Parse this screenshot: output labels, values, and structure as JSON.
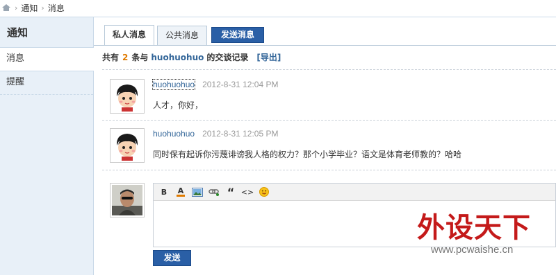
{
  "breadcrumb": {
    "home_icon": "home-icon",
    "items": [
      "通知",
      "消息"
    ],
    "separator": "›"
  },
  "sidebar": {
    "title": "通知",
    "items": [
      {
        "label": "消息",
        "active": true
      },
      {
        "label": "提醒",
        "active": false
      }
    ]
  },
  "tabs": {
    "private": "私人消息",
    "public": "公共消息",
    "send": "发送消息"
  },
  "summary": {
    "prefix": "共有",
    "count": "2",
    "mid": "条与",
    "user": "huohuohuo",
    "suffix": "的交谈记录",
    "export": "[导出]"
  },
  "messages": [
    {
      "author": "huohuohuo",
      "time": "2012-8-31 12:04 PM",
      "text": "人才，你好，",
      "avatar": "cartoon-girl-avatar"
    },
    {
      "author": "huohuohuo",
      "time": "2012-8-31 12:05 PM",
      "text": "同时保有起诉你污蔑诽谤我人格的权力？那个小学毕业？语文是体育老师教的？哈哈",
      "avatar": "cartoon-girl-avatar"
    }
  ],
  "reply": {
    "avatar": "user-photo-avatar",
    "toolbar": [
      {
        "icon": "bold-icon",
        "glyph": "B"
      },
      {
        "icon": "font-color-icon",
        "glyph": "A"
      },
      {
        "icon": "image-icon",
        "glyph": ""
      },
      {
        "icon": "link-icon",
        "glyph": ""
      },
      {
        "icon": "quote-icon",
        "glyph": "“"
      },
      {
        "icon": "code-icon",
        "glyph": "<>"
      },
      {
        "icon": "smiley-icon",
        "glyph": ""
      }
    ],
    "submit_label": "发送"
  },
  "watermark": {
    "brand": "外设天下",
    "url": "www.pcwaishe.cn"
  },
  "colors": {
    "accent_blue": "#2a5fa6",
    "link_blue": "#336699",
    "count_orange": "#e07a00",
    "sidebar_bg": "#e8f0f8",
    "watermark_red": "#c41a1a"
  }
}
